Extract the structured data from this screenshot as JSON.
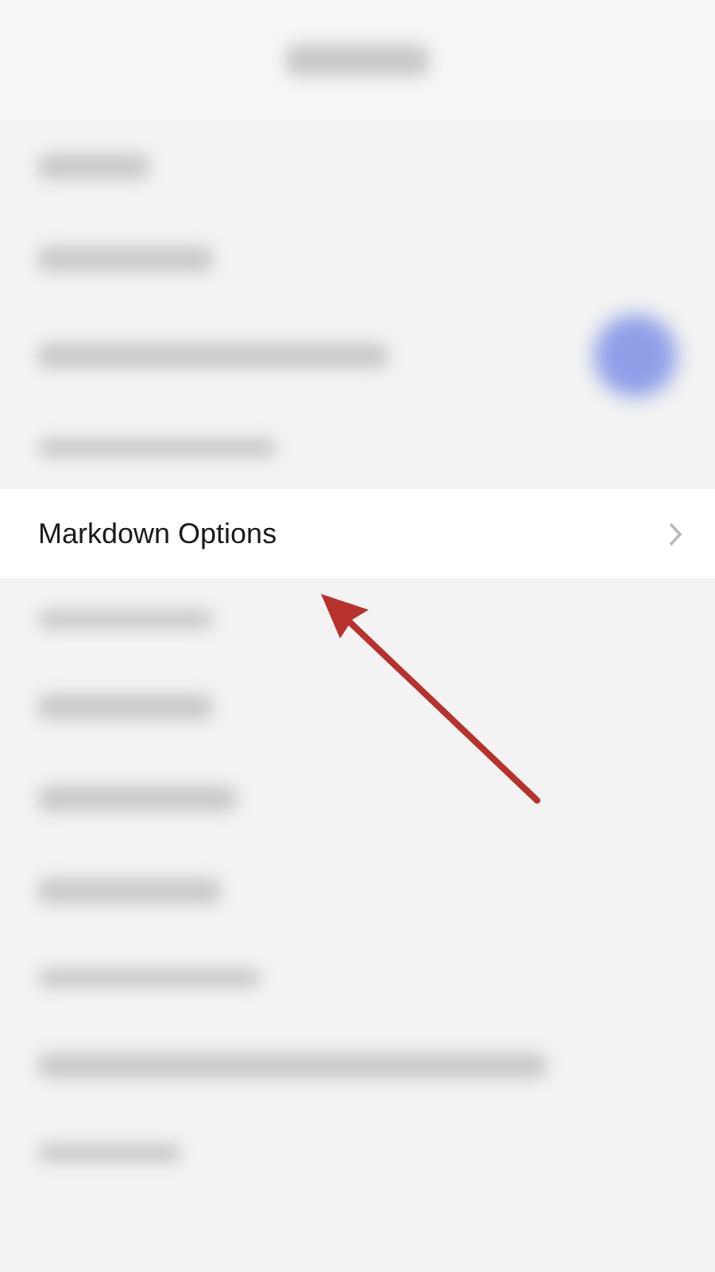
{
  "header": {
    "kind": "redacted"
  },
  "rows": [
    {
      "kind": "redacted"
    },
    {
      "kind": "redacted"
    },
    {
      "kind": "redacted-toggle"
    },
    {
      "kind": "redacted-header"
    },
    {
      "kind": "link",
      "label": "Markdown Options"
    },
    {
      "kind": "redacted-header"
    },
    {
      "kind": "redacted"
    },
    {
      "kind": "redacted"
    },
    {
      "kind": "redacted"
    },
    {
      "kind": "redacted-header"
    },
    {
      "kind": "redacted"
    },
    {
      "kind": "redacted-header"
    }
  ],
  "annotation": {
    "kind": "arrow"
  }
}
